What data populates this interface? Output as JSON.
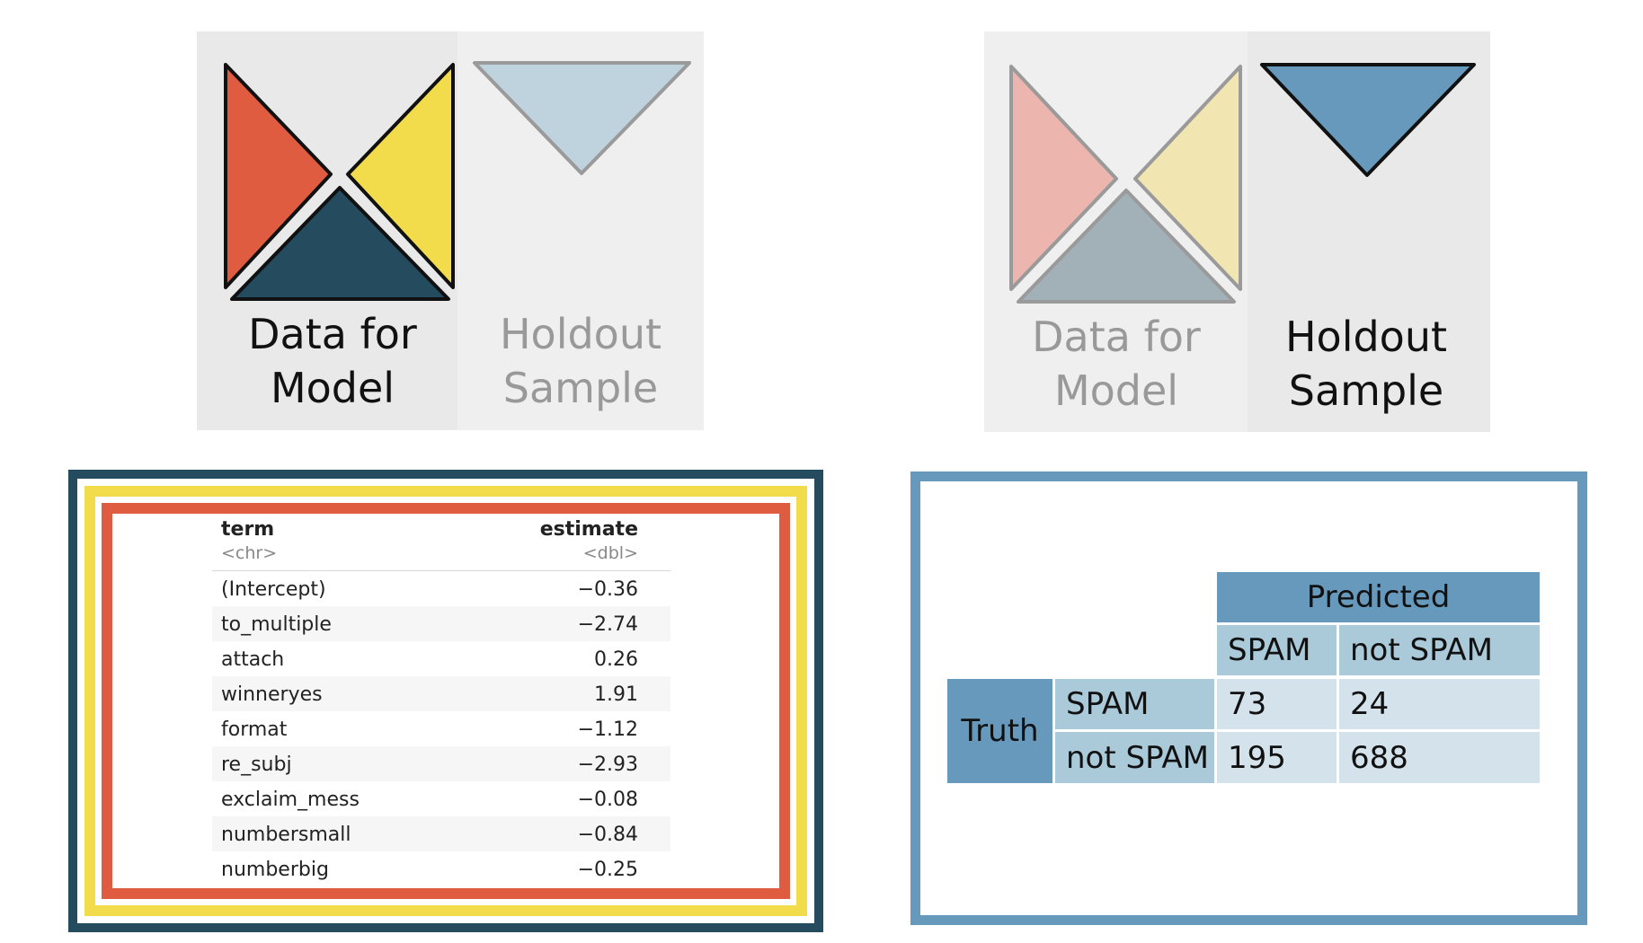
{
  "left_panel": {
    "active": {
      "line1": "Data for",
      "line2": "Model"
    },
    "inactive": {
      "line1": "Holdout",
      "line2": "Sample"
    }
  },
  "right_panel": {
    "inactive": {
      "line1": "Data for",
      "line2": "Model"
    },
    "active": {
      "line1": "Holdout",
      "line2": "Sample"
    }
  },
  "colors": {
    "red": "#e05c40",
    "yellow": "#f2dc4b",
    "navy": "#244b5e",
    "light_blue": "#bfd3df",
    "blue": "#6699bb",
    "faded_red": "#ecb5ad",
    "faded_yellow": "#f1e6b1",
    "faded_navy": "#a2b0b8"
  },
  "coef_table": {
    "columns": [
      {
        "name": "term",
        "type": "<chr>"
      },
      {
        "name": "estimate",
        "type": "<dbl>"
      }
    ],
    "rows": [
      {
        "term": "(Intercept)",
        "estimate": "−0.36"
      },
      {
        "term": "to_multiple",
        "estimate": "−2.74"
      },
      {
        "term": "attach",
        "estimate": "0.26"
      },
      {
        "term": "winneryes",
        "estimate": "1.91"
      },
      {
        "term": "format",
        "estimate": "−1.12"
      },
      {
        "term": "re_subj",
        "estimate": "−2.93"
      },
      {
        "term": "exclaim_mess",
        "estimate": "−0.08"
      },
      {
        "term": "numbersmall",
        "estimate": "−0.84"
      },
      {
        "term": "numberbig",
        "estimate": "−0.25"
      }
    ]
  },
  "confusion_matrix": {
    "predicted_header": "Predicted",
    "truth_header": "Truth",
    "pred_labels": [
      "SPAM",
      "not SPAM"
    ],
    "truth_labels": [
      "SPAM",
      "not SPAM"
    ],
    "values": [
      [
        "73",
        "24"
      ],
      [
        "195",
        "688"
      ]
    ]
  }
}
